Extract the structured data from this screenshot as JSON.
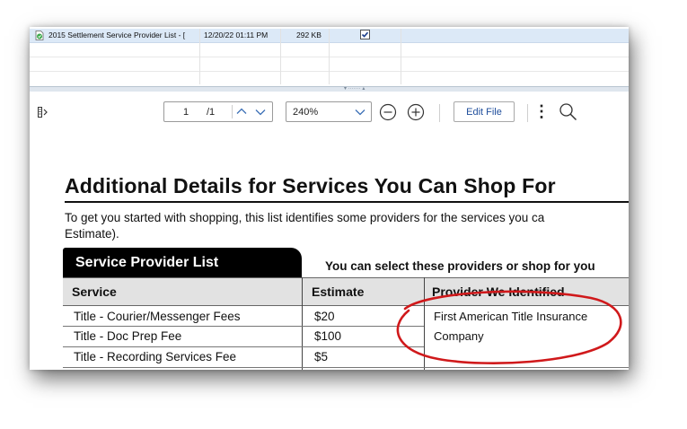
{
  "file_list": {
    "selected_row": {
      "name": "2015 Settlement Service Provider List - [",
      "modified": "12/20/22 01:11 PM",
      "size": "292 KB",
      "checked": true
    }
  },
  "toolbar": {
    "page_current": "1",
    "page_total": "/1",
    "zoom": "240%",
    "edit_file_label": "Edit File",
    "more_glyph": "⋮"
  },
  "document": {
    "title": "Additional Details for Services You Can Shop For",
    "intro_line1": "To get you started with shopping, this list identifies some providers for the services you ca",
    "intro_line2": "Estimate).",
    "tab_label": "Service Provider List",
    "shop_note": "You can select these providers or shop for you",
    "headers": {
      "service": "Service",
      "estimate": "Estimate",
      "provider": "Provider We Identified"
    },
    "rows": [
      {
        "service": "Title - Courier/Messenger Fees",
        "estimate": "$20"
      },
      {
        "service": "Title - Doc Prep Fee",
        "estimate": "$100"
      },
      {
        "service": "Title - Recording Services Fee",
        "estimate": "$5"
      }
    ],
    "provider_line1": "First American Title Insurance",
    "provider_line2": "Company"
  },
  "colors": {
    "selection": "#dce9f7",
    "annotation": "#d0191b",
    "tab": "#000000",
    "header_band": "#e2e2e2"
  },
  "icons": [
    "pdf-file-icon",
    "sidebar-toggle-icon",
    "chevron-up-icon",
    "chevron-down-icon",
    "zoom-out-icon",
    "zoom-in-icon",
    "more-options-icon",
    "search-icon",
    "checkbox-checked-icon"
  ]
}
